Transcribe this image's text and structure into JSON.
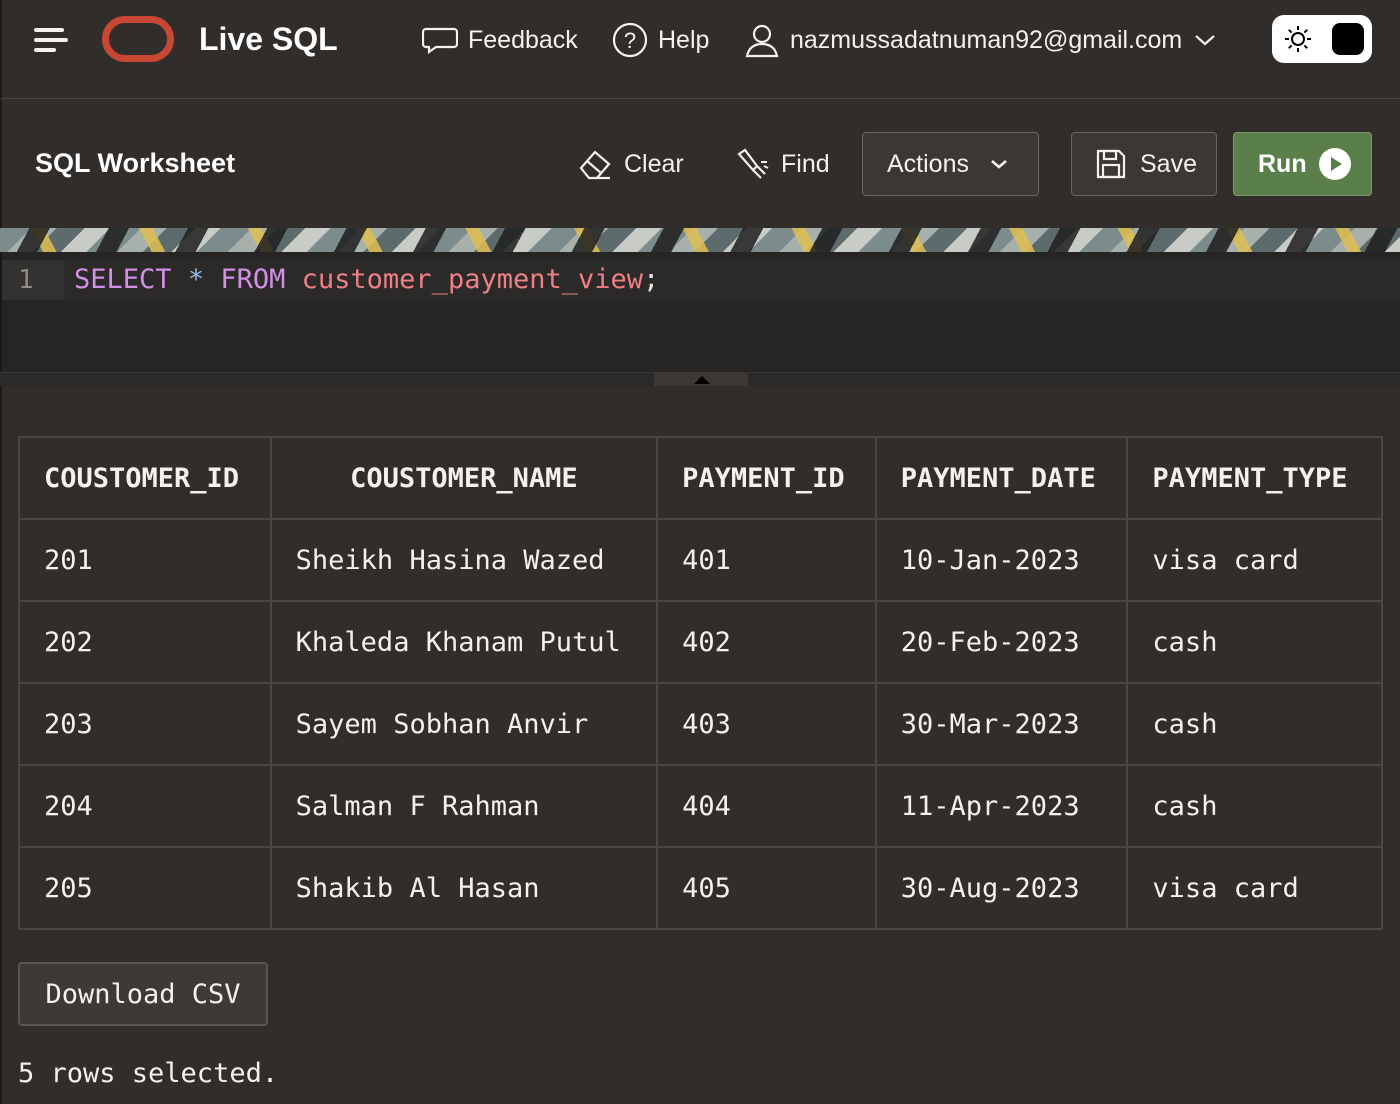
{
  "header": {
    "app_title": "Live SQL",
    "feedback_label": "Feedback",
    "help_label": "Help",
    "user_email": "nazmussadatnuman92@gmail.com"
  },
  "toolbar": {
    "title": "SQL Worksheet",
    "clear_label": "Clear",
    "find_label": "Find",
    "actions_label": "Actions",
    "save_label": "Save",
    "run_label": "Run"
  },
  "editor": {
    "line_number": "1",
    "tokens": {
      "select": "SELECT",
      "star": "*",
      "from": "FROM",
      "table": "customer_payment_view",
      "semicolon": ";"
    }
  },
  "results": {
    "columns": [
      "COUSTOMER_ID",
      "COUSTOMER_NAME",
      "PAYMENT_ID",
      "PAYMENT_DATE",
      "PAYMENT_TYPE"
    ],
    "rows": [
      [
        "201",
        "Sheikh Hasina Wazed",
        "401",
        "10-Jan-2023",
        "visa card"
      ],
      [
        "202",
        "Khaleda Khanam Putul",
        "402",
        "20-Feb-2023",
        "cash"
      ],
      [
        "203",
        "Sayem Sobhan Anvir",
        "403",
        "30-Mar-2023",
        "cash"
      ],
      [
        "204",
        "Salman F Rahman",
        "404",
        "11-Apr-2023",
        "cash"
      ],
      [
        "205",
        "Shakib Al Hasan",
        "405",
        "30-Aug-2023",
        "visa card"
      ]
    ],
    "download_label": "Download CSV",
    "status": "5 rows selected."
  },
  "colors": {
    "background": "#312d2a",
    "brand_red": "#c74634",
    "run_green": "#5b7f4a",
    "keyword": "#d48fe6",
    "identifier": "#f07f86"
  },
  "icons": [
    "menu-icon",
    "oracle-logo",
    "feedback-icon",
    "help-icon",
    "user-icon",
    "chevron-down-icon",
    "sun-icon",
    "moon-icon",
    "eraser-icon",
    "flashlight-icon",
    "save-icon",
    "play-icon"
  ]
}
